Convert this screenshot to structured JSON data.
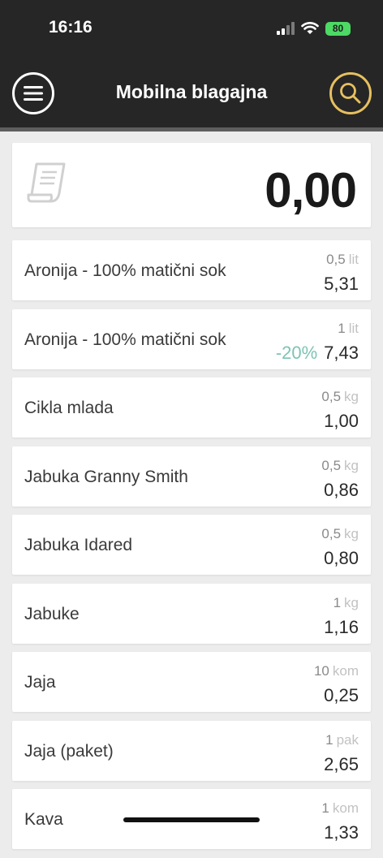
{
  "status": {
    "time": "16:16",
    "battery": "80"
  },
  "header": {
    "title": "Mobilna blagajna",
    "menu_icon": "hamburger-menu-icon",
    "search_icon": "search-icon"
  },
  "total": {
    "value": "0,00",
    "icon": "receipt-icon"
  },
  "items": [
    {
      "name": "Aronija - 100% matični sok",
      "qty": "0,5",
      "unit": "lit",
      "discount": "",
      "price": "5,31"
    },
    {
      "name": "Aronija - 100% matični sok",
      "qty": "1",
      "unit": "lit",
      "discount": "-20%",
      "price": "7,43"
    },
    {
      "name": "Cikla mlada",
      "qty": "0,5",
      "unit": "kg",
      "discount": "",
      "price": "1,00"
    },
    {
      "name": "Jabuka Granny Smith",
      "qty": "0,5",
      "unit": "kg",
      "discount": "",
      "price": "0,86"
    },
    {
      "name": "Jabuka Idared",
      "qty": "0,5",
      "unit": "kg",
      "discount": "",
      "price": "0,80"
    },
    {
      "name": "Jabuke",
      "qty": "1",
      "unit": "kg",
      "discount": "",
      "price": "1,16"
    },
    {
      "name": "Jaja",
      "qty": "10",
      "unit": "kom",
      "discount": "",
      "price": "0,25"
    },
    {
      "name": "Jaja (paket)",
      "qty": "1",
      "unit": "pak",
      "discount": "",
      "price": "2,65"
    },
    {
      "name": "Kava",
      "qty": "1",
      "unit": "kom",
      "discount": "",
      "price": "1,33"
    }
  ],
  "colors": {
    "header_bg": "#262626",
    "search_accent": "#e6c060",
    "discount": "#7cc4b4",
    "battery": "#4cd964"
  }
}
